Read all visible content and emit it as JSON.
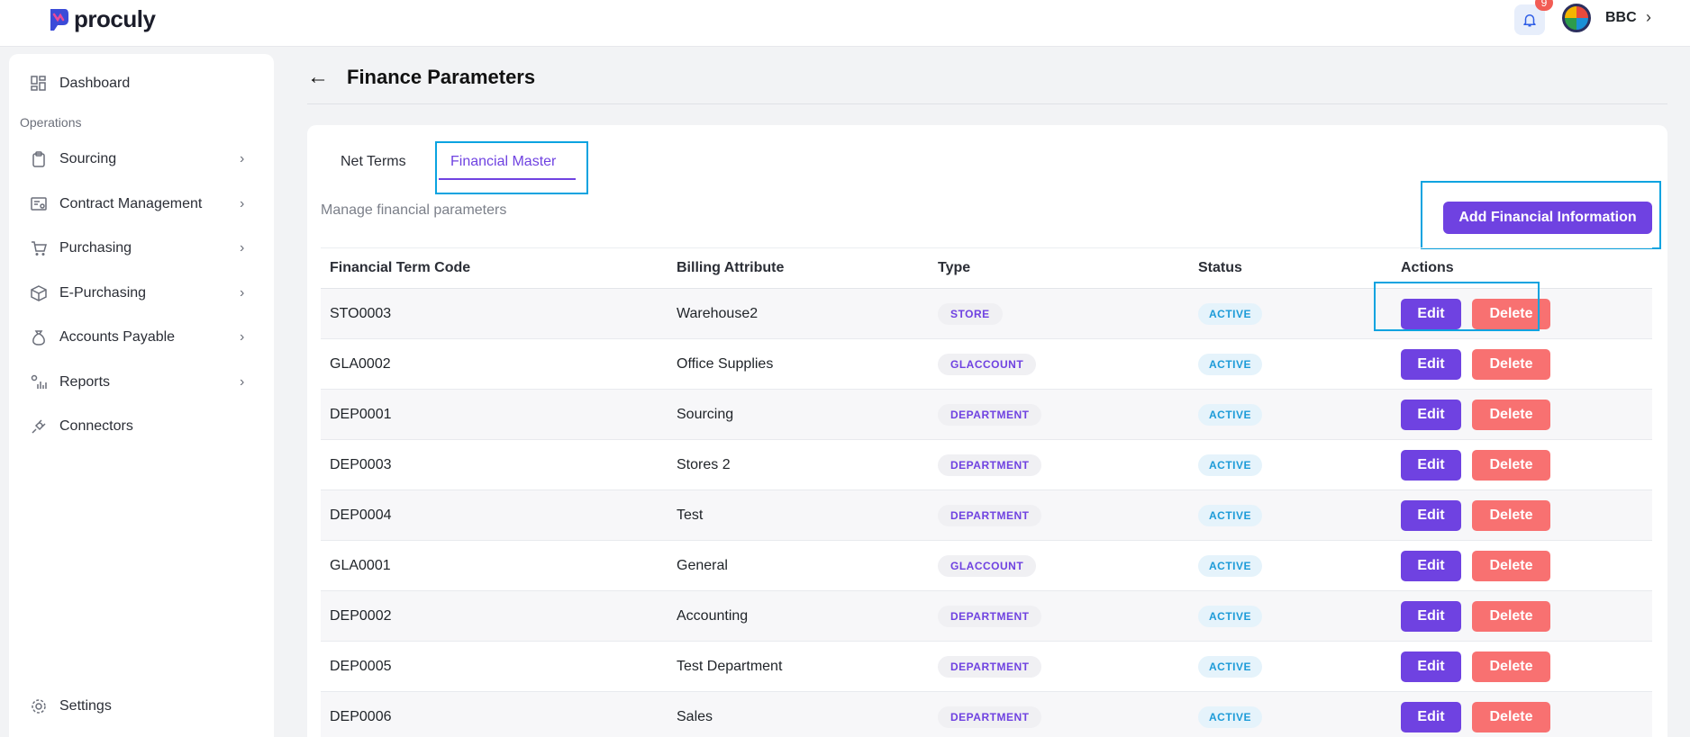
{
  "brand": {
    "name": "proculy"
  },
  "topbar": {
    "notification_count": "9",
    "user_name": "BBC"
  },
  "sidebar": {
    "section_label": "Operations",
    "items": [
      {
        "label": "Dashboard",
        "icon": "dashboard-icon"
      },
      {
        "label": "Sourcing",
        "icon": "clipboard-icon"
      },
      {
        "label": "Contract Management",
        "icon": "contract-icon"
      },
      {
        "label": "Purchasing",
        "icon": "cart-icon"
      },
      {
        "label": "E-Purchasing",
        "icon": "box-icon"
      },
      {
        "label": "Accounts Payable",
        "icon": "moneybag-icon"
      },
      {
        "label": "Reports",
        "icon": "reports-icon"
      },
      {
        "label": "Connectors",
        "icon": "plug-icon"
      },
      {
        "label": "Settings",
        "icon": "gear-icon"
      }
    ]
  },
  "page": {
    "title": "Finance Parameters",
    "tabs": [
      {
        "label": "Net Terms"
      },
      {
        "label": "Financial Master"
      }
    ],
    "subtitle": "Manage financial parameters",
    "add_button": "Add Financial Information"
  },
  "table": {
    "headers": [
      "Financial Term Code",
      "Billing Attribute",
      "Type",
      "Status",
      "Actions"
    ],
    "edit_label": "Edit",
    "delete_label": "Delete",
    "rows": [
      {
        "code": "STO0003",
        "attribute": "Warehouse2",
        "type": "STORE",
        "status": "ACTIVE"
      },
      {
        "code": "GLA0002",
        "attribute": "Office Supplies",
        "type": "GLACCOUNT",
        "status": "ACTIVE"
      },
      {
        "code": "DEP0001",
        "attribute": "Sourcing",
        "type": "DEPARTMENT",
        "status": "ACTIVE"
      },
      {
        "code": "DEP0003",
        "attribute": "Stores 2",
        "type": "DEPARTMENT",
        "status": "ACTIVE"
      },
      {
        "code": "DEP0004",
        "attribute": "Test",
        "type": "DEPARTMENT",
        "status": "ACTIVE"
      },
      {
        "code": "GLA0001",
        "attribute": "General",
        "type": "GLACCOUNT",
        "status": "ACTIVE"
      },
      {
        "code": "DEP0002",
        "attribute": "Accounting",
        "type": "DEPARTMENT",
        "status": "ACTIVE"
      },
      {
        "code": "DEP0005",
        "attribute": "Test Department",
        "type": "DEPARTMENT",
        "status": "ACTIVE"
      },
      {
        "code": "DEP0006",
        "attribute": "Sales",
        "type": "DEPARTMENT",
        "status": "ACTIVE"
      }
    ]
  },
  "colors": {
    "accent": "#6f42e1",
    "delete": "#f87171",
    "status": "#1d9bd8",
    "highlight": "#0aa3e0"
  }
}
